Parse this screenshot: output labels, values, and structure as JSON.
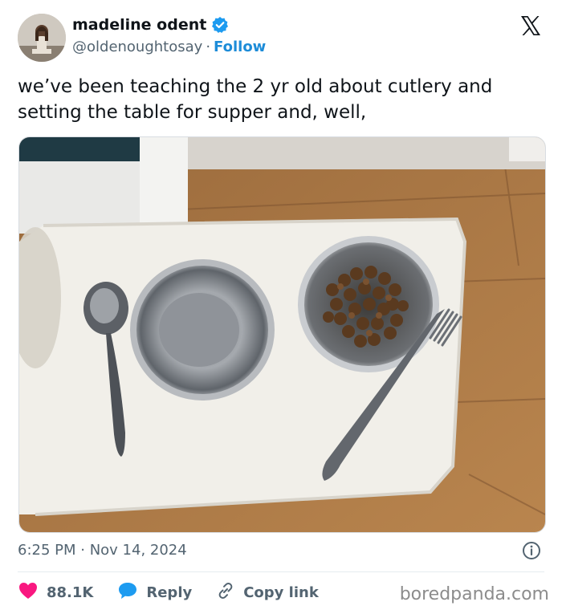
{
  "author": {
    "name": "madeline odent",
    "handle": "@oldenoughtosay",
    "follow_label": "Follow",
    "separator": "·"
  },
  "tweet": {
    "text": "we’ve been teaching the 2 yr old about cutlery and setting the table for supper and, well,",
    "timestamp": "6:25 PM · Nov 14, 2024"
  },
  "actions": {
    "likes": "88.1K",
    "reply_label": "Reply",
    "copy_link_label": "Copy link"
  },
  "watermark": "boredpanda.com",
  "colors": {
    "accent_blue": "#1d8cd8",
    "like_red": "#f91880",
    "text_primary": "#0f1419",
    "text_secondary": "#536471"
  },
  "icons": {
    "verified": "verified-badge-icon",
    "x_logo": "x-logo-icon",
    "info": "info-icon",
    "heart": "heart-icon",
    "reply": "reply-bubble-icon",
    "link": "link-icon"
  }
}
